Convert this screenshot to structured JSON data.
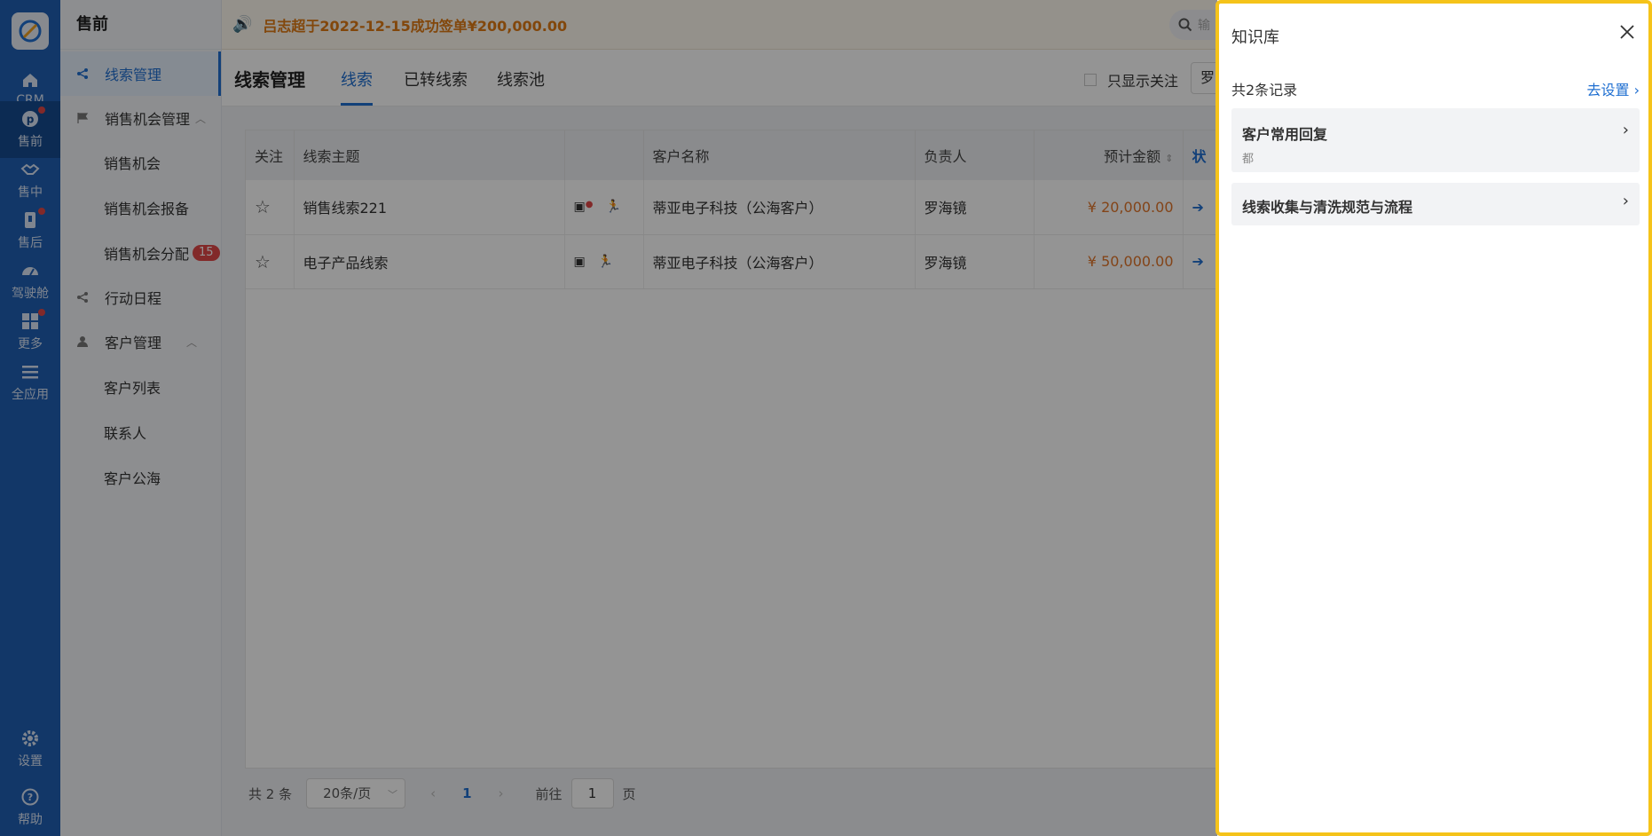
{
  "rail": {
    "items": [
      {
        "label": "CRM",
        "icon": "home-icon"
      },
      {
        "label": "售前",
        "icon": "pinterest-icon"
      },
      {
        "label": "售中",
        "icon": "handshake-icon"
      },
      {
        "label": "售后",
        "icon": "badge-icon"
      },
      {
        "label": "驾驶舱",
        "icon": "dashboard-icon"
      },
      {
        "label": "更多",
        "icon": "grid-icon"
      },
      {
        "label": "全应用",
        "icon": "list-icon"
      },
      {
        "label": "设置",
        "icon": "gear-icon"
      },
      {
        "label": "帮助",
        "icon": "help-icon"
      }
    ]
  },
  "menu": {
    "title": "售前",
    "items": [
      {
        "label": "线索管理"
      },
      {
        "label": "销售机会管理"
      },
      {
        "label": "销售机会"
      },
      {
        "label": "销售机会报备"
      },
      {
        "label": "销售机会分配",
        "badge": "15"
      },
      {
        "label": "行动日程"
      },
      {
        "label": "客户管理"
      },
      {
        "label": "客户列表"
      },
      {
        "label": "联系人"
      },
      {
        "label": "客户公海"
      }
    ]
  },
  "notice": {
    "text": "吕志超于2022-12-15成功签单¥200,000.00"
  },
  "search": {
    "placeholder": "输"
  },
  "header": {
    "title": "线索管理",
    "tabs": [
      "线索",
      "已转线索",
      "线索池"
    ],
    "follow_label": "只显示关注",
    "owner_value": "罗"
  },
  "table": {
    "columns": [
      "关注",
      "线索主题",
      "",
      "客户名称",
      "负责人",
      "预计金额",
      "状"
    ],
    "rows": [
      {
        "subject": "销售线索221",
        "customer": "蒂亚电子科技（公海客户）",
        "owner": "罗海镜",
        "amount": "¥ 20,000.00"
      },
      {
        "subject": "电子产品线索",
        "customer": "蒂亚电子科技（公海客户）",
        "owner": "罗海镜",
        "amount": "¥ 50,000.00"
      }
    ]
  },
  "pager": {
    "total": "共 2 条",
    "per_page": "20条/页",
    "current": "1",
    "goto_label": "前往",
    "goto_value": "1",
    "page_unit": "页"
  },
  "drawer": {
    "title": "知识库",
    "count": "共2条记录",
    "settings_link": "去设置",
    "items": [
      {
        "title": "客户常用回复",
        "sub": "都"
      },
      {
        "title": "线索收集与清洗规范与流程",
        "sub": ""
      }
    ]
  },
  "colors": {
    "accent": "#1f6fd1",
    "rail": "#1f5fb3",
    "highlight_border": "#f5c31a",
    "amount": "#e2762a",
    "badge": "#e04848"
  }
}
